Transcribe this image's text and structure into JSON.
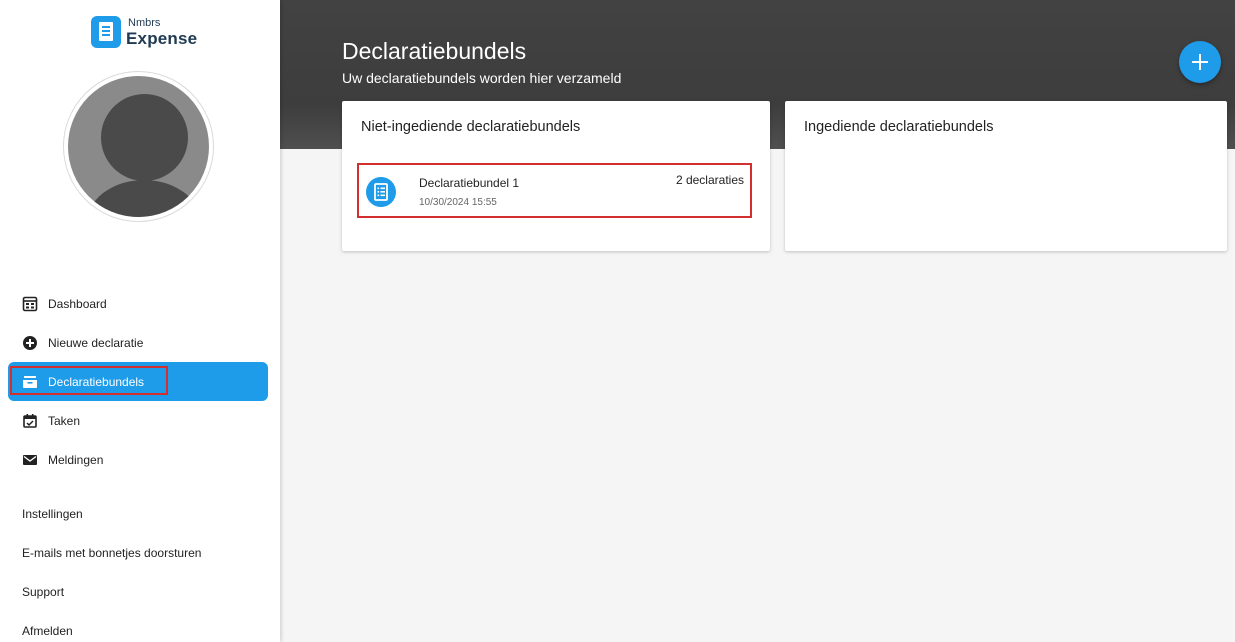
{
  "logo": {
    "small": "Nmbrs",
    "big": "Expense"
  },
  "nav": {
    "items": [
      {
        "label": "Dashboard",
        "icon": "dashboard-icon"
      },
      {
        "label": "Nieuwe declaratie",
        "icon": "add-circle-icon"
      },
      {
        "label": "Declaratiebundels",
        "icon": "inbox-icon",
        "active": true
      },
      {
        "label": "Taken",
        "icon": "calendar-check-icon"
      },
      {
        "label": "Meldingen",
        "icon": "mail-icon"
      }
    ],
    "links": [
      {
        "label": "Instellingen"
      },
      {
        "label": "E-mails met bonnetjes doorsturen"
      },
      {
        "label": "Support"
      },
      {
        "label": "Afmelden"
      }
    ]
  },
  "header": {
    "title": "Declaratiebundels",
    "subtitle": "Uw declaratiebundels worden hier verzameld"
  },
  "cards": {
    "not_submitted": {
      "title": "Niet-ingediende declaratiebundels",
      "bundles": [
        {
          "name": "Declaratiebundel 1",
          "date": "10/30/2024 15:55",
          "count": "2 declaraties"
        }
      ]
    },
    "submitted": {
      "title": "Ingediende declaratiebundels"
    }
  },
  "colors": {
    "accent": "#1e9be9",
    "header_bg": "#424242",
    "highlight": "#d32f2f"
  }
}
